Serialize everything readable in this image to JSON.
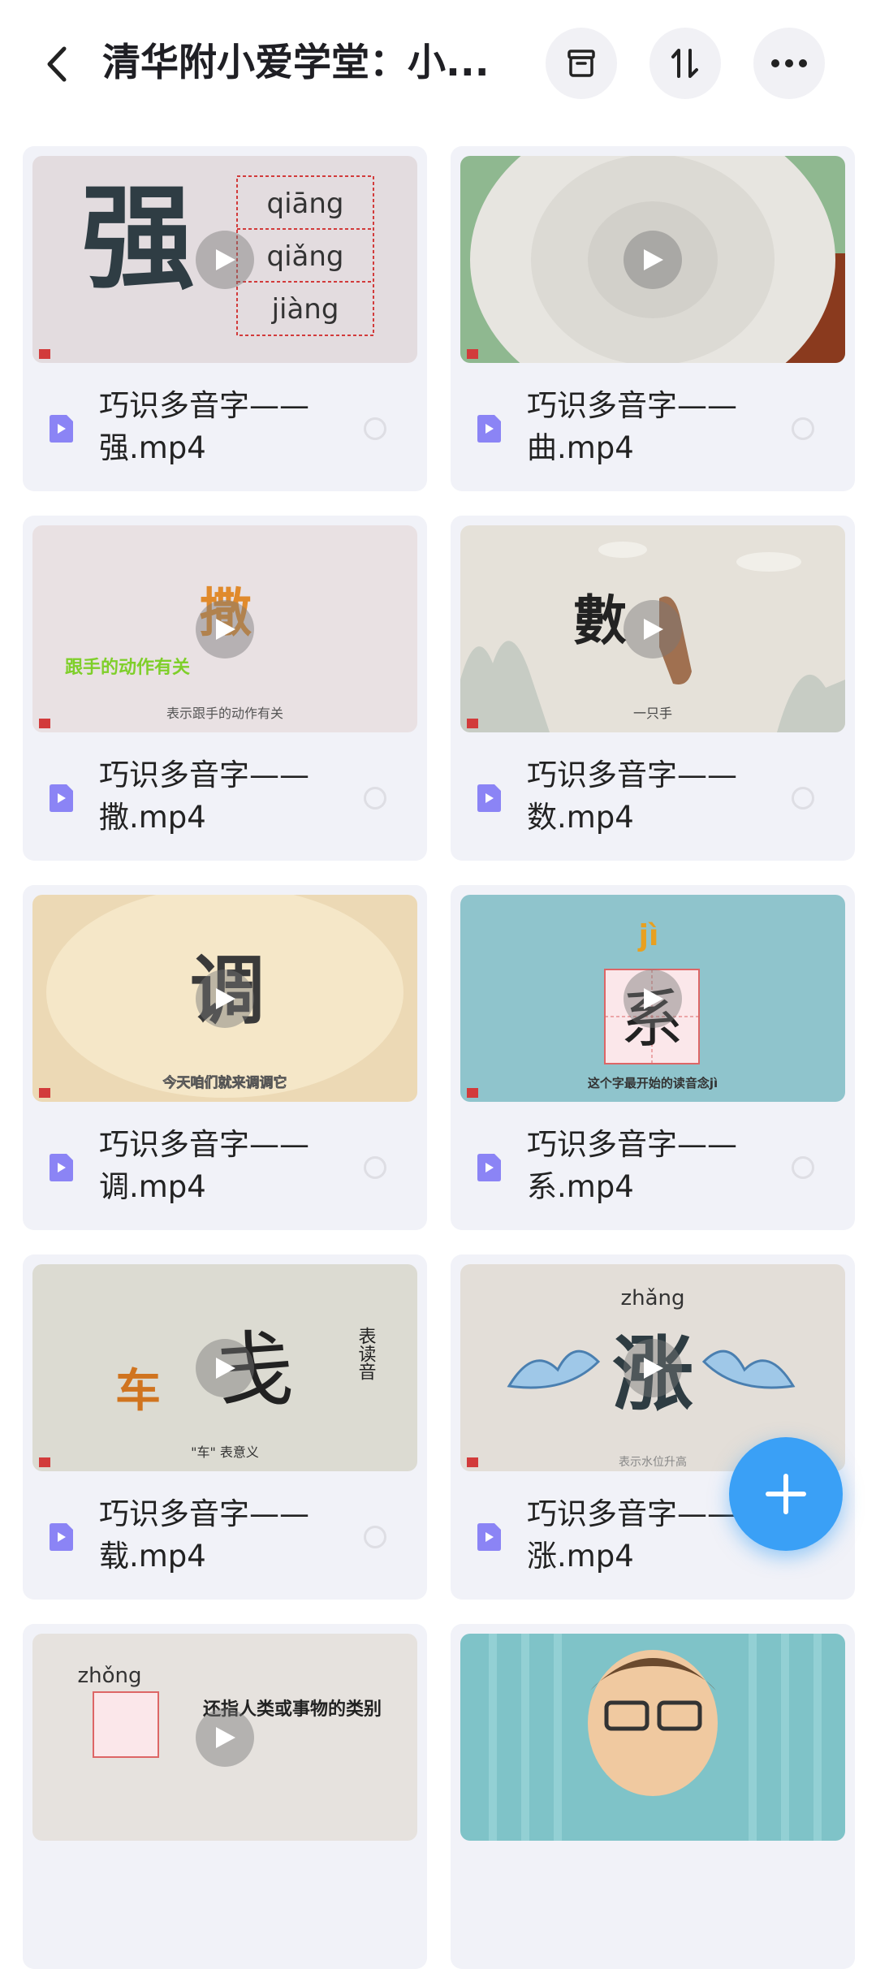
{
  "header": {
    "title": "清华附小爱学堂：小...",
    "back_icon": "chevron-left-icon",
    "archive_icon": "archive-box-icon",
    "sort_icon": "sort-up-down-icon",
    "more_icon": "more-horizontal-icon"
  },
  "files": [
    {
      "name": "巧识多音字——\n强.mp4",
      "thumb": {
        "char": "强",
        "pinyin": [
          "qiāng",
          "qiǎng",
          "jiàng"
        ]
      }
    },
    {
      "name": "巧识多音字——\n曲.mp4",
      "thumb": {}
    },
    {
      "name": "巧识多音字——\n撒.mp4",
      "thumb": {
        "char": "撒",
        "caption": "跟手的动作有关",
        "subtitle": "表示跟手的动作有关"
      }
    },
    {
      "name": "巧识多音字——\n数.mp4",
      "thumb": {
        "char": "數",
        "subtitle": "一只手"
      }
    },
    {
      "name": "巧识多音字——\n调.mp4",
      "thumb": {
        "char": "调",
        "subtitle": "今天咱们就来调调它"
      }
    },
    {
      "name": "巧识多音字——\n系.mp4",
      "thumb": {
        "char": "系",
        "pinyin": [
          "jì"
        ],
        "subtitle": "这个字最开始的读音念jì"
      }
    },
    {
      "name": "巧识多音字——\n载.mp4",
      "thumb": {
        "char": "戋",
        "char2": "车",
        "side": "表读音",
        "subtitle": "\"车\" 表意义"
      }
    },
    {
      "name": "巧识多音字——\n涨.mp4",
      "thumb": {
        "char": "涨",
        "pinyin": [
          "zhǎng"
        ],
        "subtitle": "表示水位升高"
      }
    },
    {
      "name": "",
      "thumb": {
        "pinyin": [
          "zhǒng"
        ],
        "caption": "还指人类或事物的类别"
      }
    },
    {
      "name": "",
      "thumb": {}
    }
  ],
  "fab": {
    "icon": "plus-icon"
  },
  "colors": {
    "accent": "#3aa0f6",
    "file_icon": "#8b84f5",
    "card_bg": "#f1f2f8"
  }
}
